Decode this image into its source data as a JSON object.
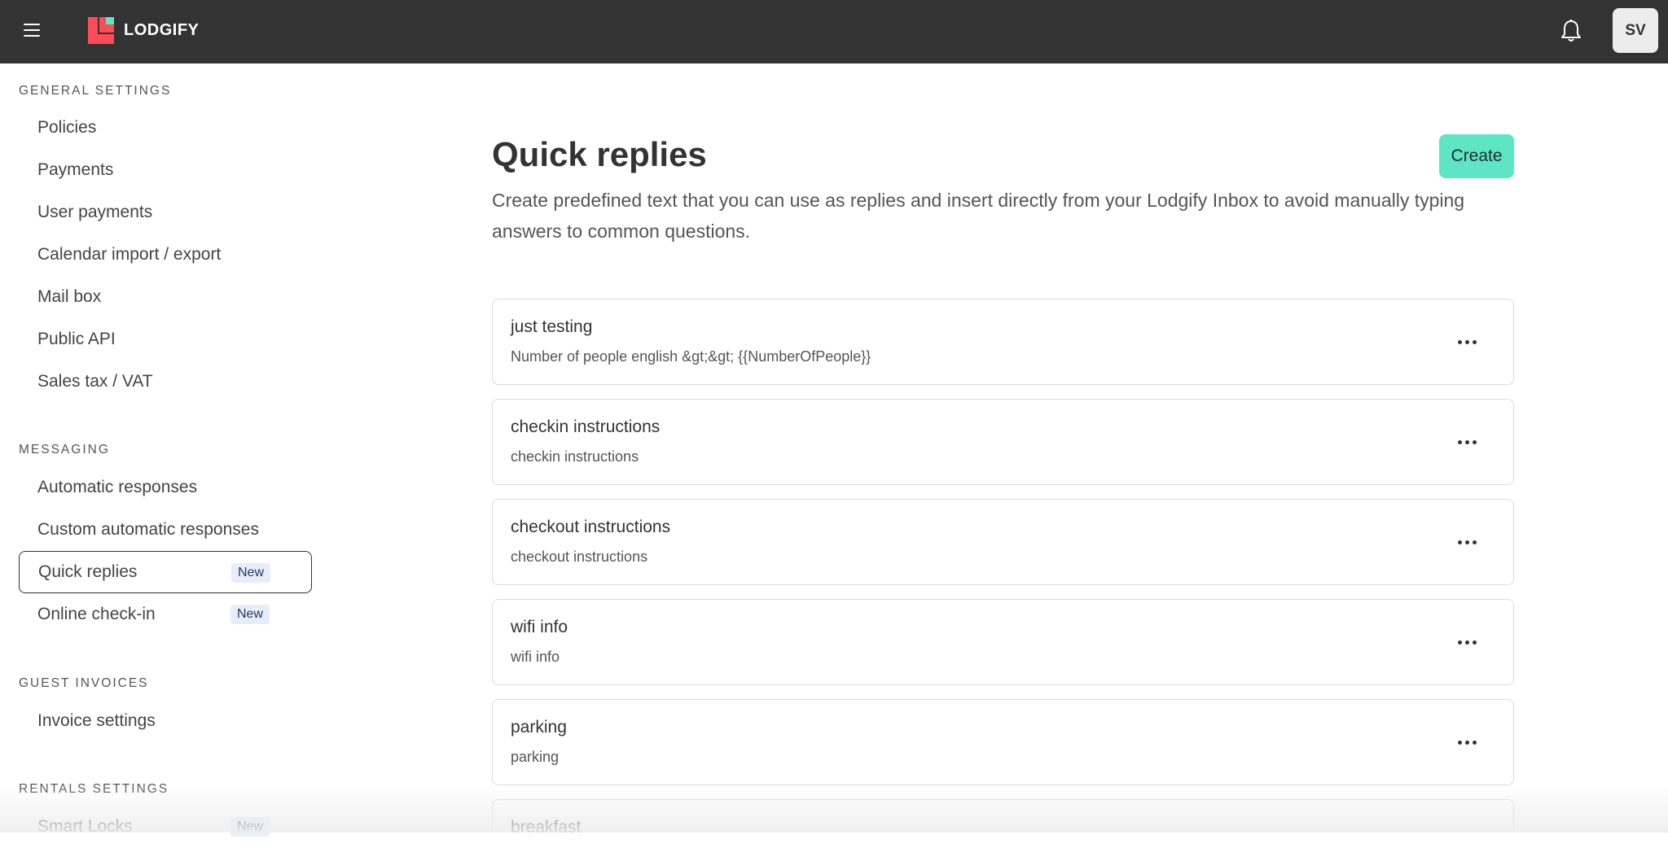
{
  "header": {
    "logo_text": "LODGIFY",
    "avatar_initials": "SV",
    "colors": {
      "bar": "#333333",
      "logo_red": "#ff4a5a",
      "logo_green": "#5ee6c4"
    }
  },
  "sidebar": {
    "sections": [
      {
        "title": "GENERAL SETTINGS",
        "items": [
          {
            "label": "Policies"
          },
          {
            "label": "Payments"
          },
          {
            "label": "User payments"
          },
          {
            "label": "Calendar import / export"
          },
          {
            "label": "Mail box"
          },
          {
            "label": "Public API"
          },
          {
            "label": "Sales tax / VAT"
          }
        ]
      },
      {
        "title": "MESSAGING",
        "items": [
          {
            "label": "Automatic responses"
          },
          {
            "label": "Custom automatic responses"
          },
          {
            "label": "Quick replies",
            "badge": "New",
            "active": true
          },
          {
            "label": "Online check-in",
            "badge": "New"
          }
        ]
      },
      {
        "title": "GUEST INVOICES",
        "items": [
          {
            "label": "Invoice settings"
          }
        ]
      },
      {
        "title": "RENTALS SETTINGS",
        "items": [
          {
            "label": "Smart Locks",
            "badge": "New"
          }
        ]
      }
    ]
  },
  "main": {
    "title": "Quick replies",
    "description": "Create predefined text that you can use as replies and insert directly from your Lodgify Inbox to avoid manually typing answers to common questions.",
    "create_label": "Create",
    "accent_color": "#5ee6c4",
    "replies": [
      {
        "title": "just testing",
        "text": "Number of people english &gt;&gt; {{NumberOfPeople}}"
      },
      {
        "title": "checkin instructions",
        "text": "checkin instructions"
      },
      {
        "title": "checkout instructions",
        "text": "checkout instructions"
      },
      {
        "title": "wifi info",
        "text": "wifi info"
      },
      {
        "title": "parking",
        "text": "parking"
      },
      {
        "title": "breakfast",
        "text": ""
      }
    ]
  }
}
